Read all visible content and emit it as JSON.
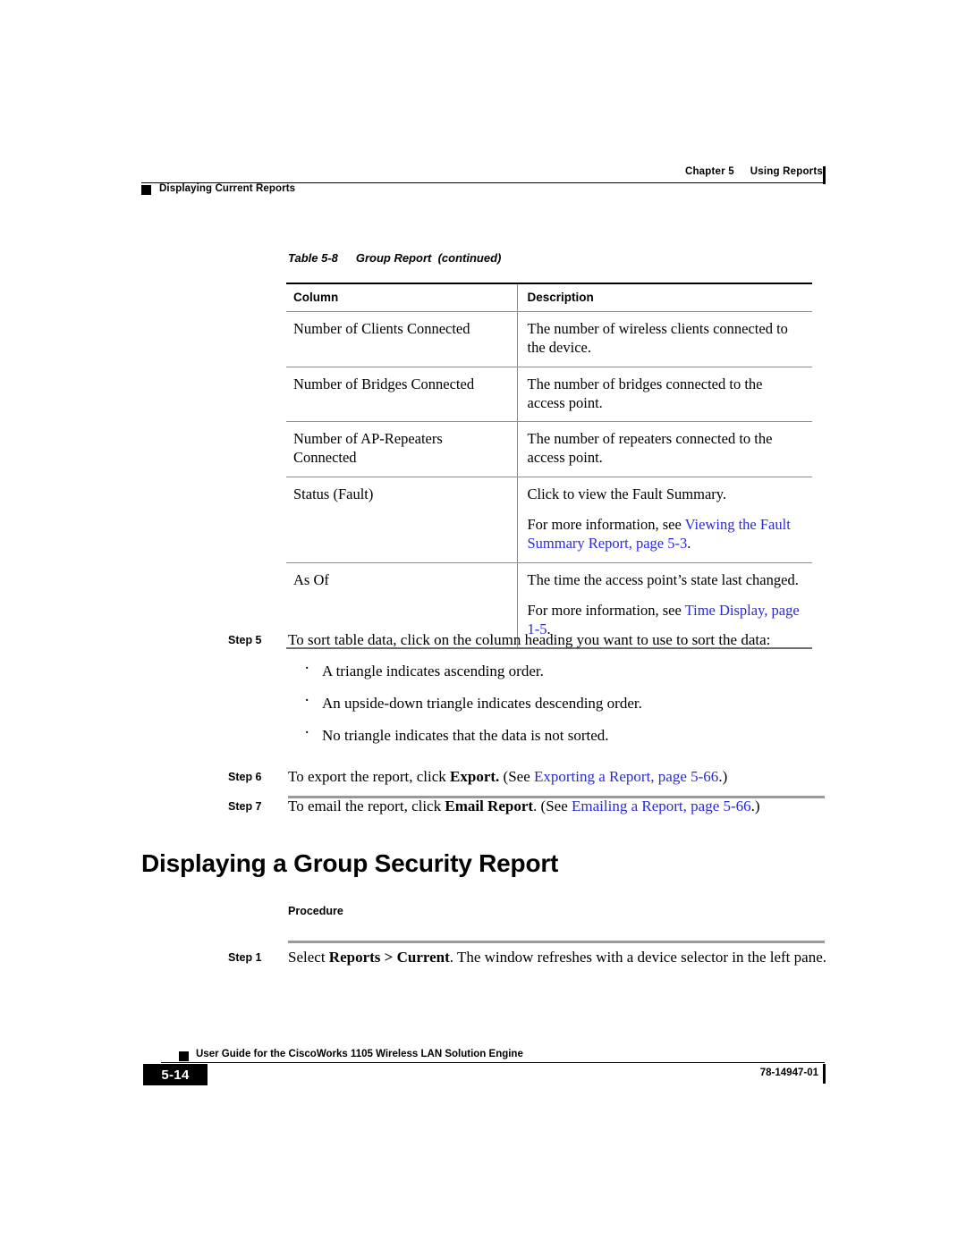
{
  "header": {
    "chapter": "Chapter 5",
    "chapter_title": "Using Reports",
    "section": "Displaying Current Reports"
  },
  "table": {
    "caption_number": "Table 5-8",
    "caption_title": "Group Report  (continued)",
    "columns": [
      "Column",
      "Description"
    ],
    "rows": [
      {
        "column": "Number of Clients Connected",
        "description": [
          {
            "text": "The number of wireless clients connected to the device."
          }
        ]
      },
      {
        "column": "Number of Bridges Connected",
        "description": [
          {
            "text": "The number of bridges connected to the access point."
          }
        ]
      },
      {
        "column": "Number of AP-Repeaters Connected",
        "description": [
          {
            "text": "The number of repeaters connected to the access point."
          }
        ]
      },
      {
        "column": "Status (Fault)",
        "description": [
          {
            "text": "Click to view the Fault Summary."
          },
          {
            "text": "For more information, see ",
            "link": "Viewing the Fault Summary Report, page 5-3",
            "after": "."
          }
        ]
      },
      {
        "column": "As Of",
        "description": [
          {
            "text": "The time the access point’s state last changed."
          },
          {
            "text": "For more information, see ",
            "link": "Time Display, page 1-5",
            "after": "."
          }
        ]
      }
    ]
  },
  "steps_group": [
    {
      "label": "Step 5",
      "intro": "To sort table data, click on the column heading you want to use to sort the data:",
      "bullets": [
        "A triangle indicates ascending order.",
        "An upside-down triangle indicates descending order.",
        "No triangle indicates that the data is not sorted."
      ]
    },
    {
      "label": "Step 6",
      "pre": "To export the report, click ",
      "bold": "Export.",
      "mid": " (See ",
      "link": "Exporting a Report, page 5-66",
      "post": ".)"
    },
    {
      "label": "Step 7",
      "pre": "To email the report, click ",
      "bold": "Email Report",
      "mid": ". (See ",
      "link": "Emailing a Report, page 5-66",
      "post": ".)"
    }
  ],
  "section": {
    "heading": "Displaying a Group Security Report",
    "subhead": "Procedure",
    "step": {
      "label": "Step 1",
      "pre": "Select ",
      "bold": "Reports > Current",
      "post": ". The window refreshes with a device selector in the left pane."
    }
  },
  "footer": {
    "guide_title": "User Guide for the CiscoWorks 1105 Wireless LAN Solution Engine",
    "page_number": "5-14",
    "doc_number": "78-14947-01"
  },
  "colors": {
    "link": "#2b2bd4",
    "rule_gray": "#9a9a9a",
    "text": "#000000"
  }
}
